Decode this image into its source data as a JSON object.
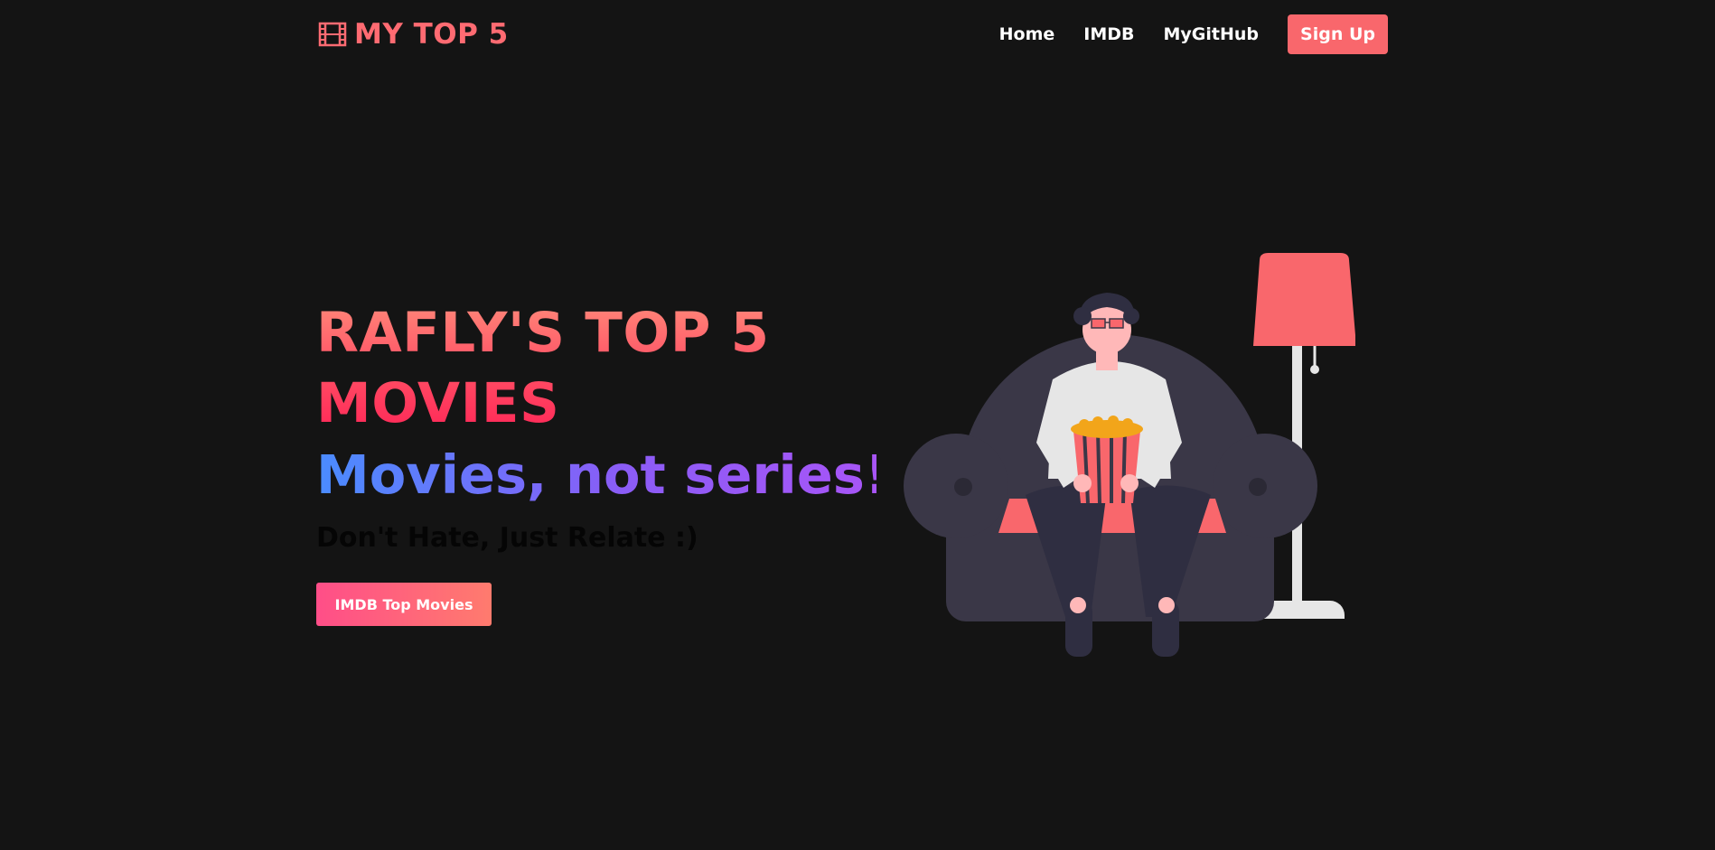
{
  "navbar": {
    "brand_icon": "film-icon",
    "brand_text": "MY TOP 5",
    "links": [
      {
        "label": "Home"
      },
      {
        "label": "IMDB"
      },
      {
        "label": "MyGitHub"
      }
    ],
    "signup_label": "Sign Up"
  },
  "hero": {
    "title_line1": "RAFLY'S TOP 5",
    "title_line2": "MOVIES",
    "subtitle": "Movies, not series!",
    "tagline": "Don't Hate, Just Relate :)",
    "cta_label": "IMDB Top Movies"
  },
  "illustration": {
    "icon": "person-watching-movie-illustration"
  },
  "colors": {
    "background": "#141414",
    "accent": "#f9676c",
    "chair": "#3a3747",
    "shirt": "#e6e6e6"
  }
}
